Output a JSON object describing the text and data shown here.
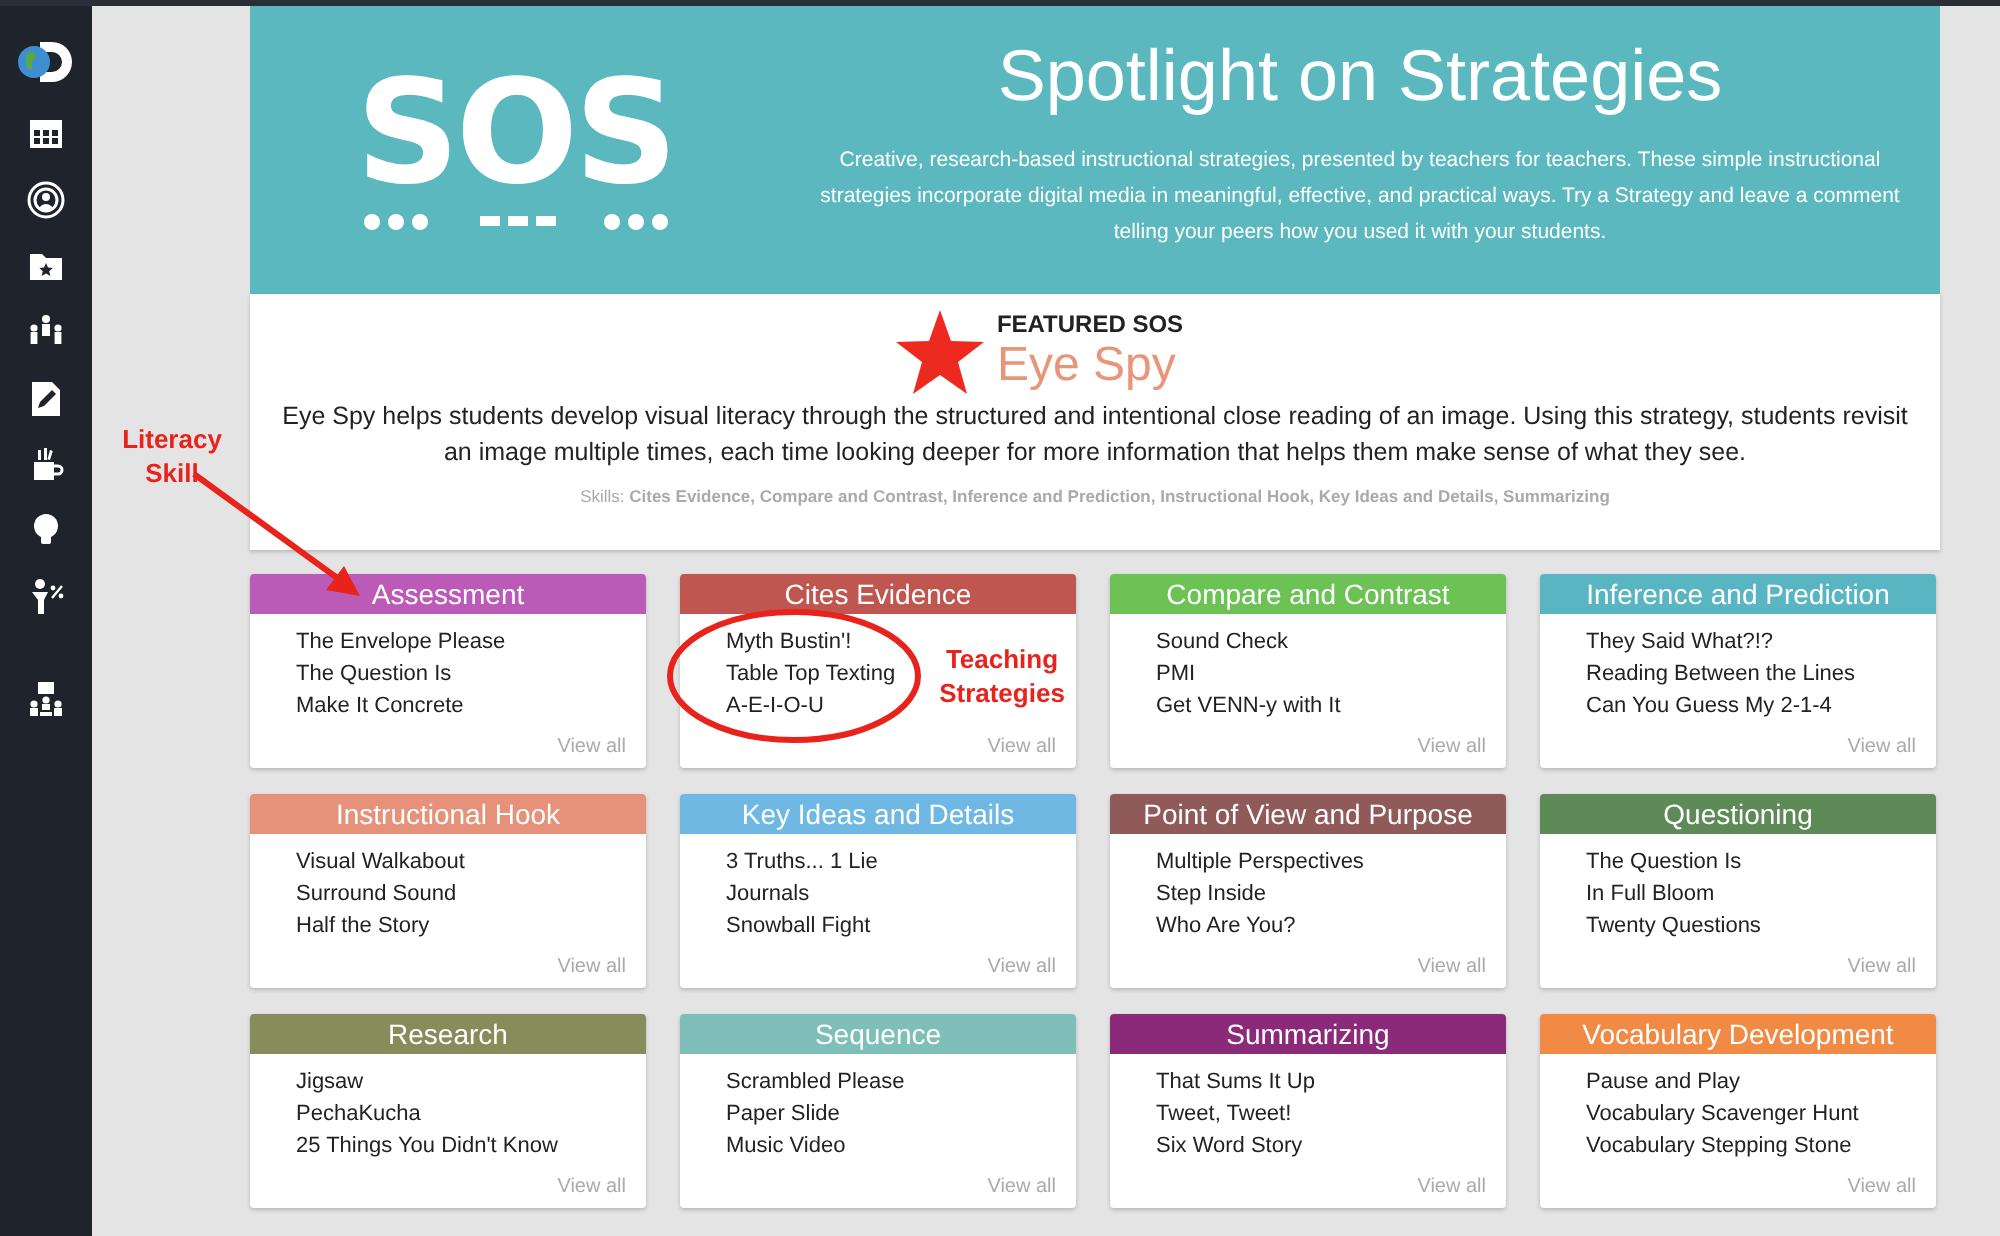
{
  "header": {
    "logo": "SOS",
    "title": "Spotlight on Strategies",
    "description": "Creative, research-based instructional strategies, presented by teachers for teachers. These simple instructional strategies incorporate digital media in meaningful, effective, and practical ways. Try a Strategy and leave a comment telling your peers how you used it with your students."
  },
  "featured": {
    "label": "FEATURED SOS",
    "title": "Eye Spy",
    "description": "Eye Spy helps students develop visual literacy through the structured and intentional close reading of an image. Using this strategy, students revisit an image multiple times, each time looking deeper for more information that helps them make sense of what they see.",
    "skills": "Skills: **Cites Evidence, Compare and Contrast, Inference and Prediction, Instructional Hook, Key Ideas and Details, Summarizing**"
  },
  "categories": [
    {
      "title": "Assessment",
      "color": "#bb5ab7",
      "strategies": [
        "The Envelope Please",
        "The Question Is",
        "Make It Concrete"
      ],
      "link": "View all"
    },
    {
      "title": "Cites Evidence",
      "color": "#c05650",
      "strategies": [
        "Myth Bustin'!",
        "Table Top Texting",
        "A-E-I-O-U"
      ],
      "link": "View all"
    },
    {
      "title": "Compare and Contrast",
      "color": "#6cc254",
      "strategies": [
        "Sound Check",
        "PMI",
        "Get VENN-y with It"
      ],
      "link": "View all"
    },
    {
      "title": "Inference and Prediction",
      "color": "#5ab5c3",
      "strategies": [
        "They Said What?!?",
        "Reading Between the Lines",
        "Can You Guess My 2-1-4"
      ],
      "link": "View all"
    },
    {
      "title": "Instructional Hook",
      "color": "#e6917a",
      "strategies": [
        "Visual Walkabout",
        "Surround Sound",
        "Half the Story"
      ],
      "link": "View all"
    },
    {
      "title": "Key Ideas and Details",
      "color": "#70b8e4",
      "strategies": [
        "3 Truths... 1 Lie",
        "Journals",
        "Snowball Fight"
      ],
      "link": "View all"
    },
    {
      "title": "Point of View and Purpose",
      "color": "#905a58",
      "strategies": [
        "Multiple Perspectives",
        "Step Inside",
        "Who Are You?"
      ],
      "link": "View all"
    },
    {
      "title": "Questioning",
      "color": "#5e8a58",
      "strategies": [
        "The Question Is",
        "In Full Bloom",
        "Twenty Questions"
      ],
      "link": "View all"
    },
    {
      "title": "Research",
      "color": "#878d5a",
      "strategies": [
        "Jigsaw",
        "PechaKucha",
        "25 Things You Didn't Know"
      ],
      "link": "View all"
    },
    {
      "title": "Sequence",
      "color": "#7fbfba",
      "strategies": [
        "Scrambled Please",
        "Paper Slide",
        "Music Video"
      ],
      "link": "View all"
    },
    {
      "title": "Summarizing",
      "color": "#8c2a7a",
      "strategies": [
        "That Sums It Up",
        "Tweet, Tweet!",
        "Six Word Story"
      ],
      "link": "View all"
    },
    {
      "title": "Vocabulary Development",
      "color": "#f08a45",
      "strategies": [
        "Pause and Play",
        "Vocabulary Scavenger Hunt",
        "Vocabulary Stepping Stone"
      ],
      "link": "View all"
    }
  ],
  "annotations": [
    {
      "kind": "arrow",
      "text": "Literacy Skill"
    },
    {
      "kind": "circle",
      "text": "Teaching Strategies"
    }
  ]
}
